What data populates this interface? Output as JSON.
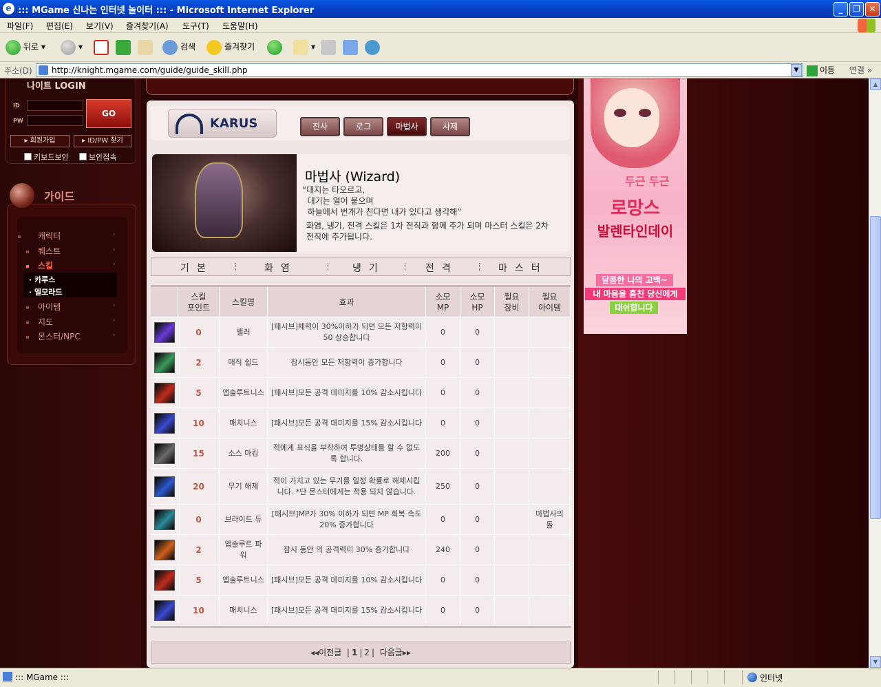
{
  "window": {
    "title": "::: MGame 신나는 인터넷 놀이터 ::: - Microsoft Internet Explorer"
  },
  "menu": [
    "파일(F)",
    "편집(E)",
    "보기(V)",
    "즐겨찾기(A)",
    "도구(T)",
    "도움말(H)"
  ],
  "toolbar": {
    "back": "뒤로",
    "search": "검색",
    "favorites": "즐겨찾기"
  },
  "address": {
    "label": "주소(D)",
    "url": "http://knight.mgame.com/guide/guide_skill.php",
    "go": "이동",
    "links": "연결"
  },
  "login": {
    "title": "나이트 LOGIN",
    "id_label": "ID",
    "pw_label": "PW",
    "go": "GO",
    "join": "회원가입",
    "find": "ID/PW 찾기",
    "keyboard_security": "키보드보안",
    "secure_login": "보안접속"
  },
  "guide": {
    "title": "가이드",
    "items": [
      "캐릭터",
      "퀘스트",
      "스킬",
      "아이템",
      "지도",
      "몬스터/NPC"
    ],
    "active": "스킬",
    "submenu": [
      "· 카루스",
      "· 엘모라드"
    ]
  },
  "faction": {
    "name": "KARUS",
    "classes": [
      "전사",
      "로그",
      "마법사",
      "사제"
    ],
    "active_class": "마법사"
  },
  "banner": {
    "class_name": "마법사 (Wizard)",
    "quote": "“대지는 타오르고,\n  대기는 얼어 붙으며\n  하늘에서 번개가 친다면 내가 있다고 생각해”",
    "description": "화염, 냉기, 전격 스킬은 1차 전직과 함께 추가 되며 마스터 스킬은 2차 전직에 추가됩니다."
  },
  "skill_tabs": [
    "기본",
    "화염",
    "냉기",
    "전격",
    "마스터"
  ],
  "table": {
    "headers": [
      "",
      "스킬\n포인트",
      "스킬명",
      "효과",
      "소모\nMP",
      "소모\nHP",
      "필요\n장비",
      "필요\n아이템"
    ],
    "rows": [
      {
        "icon": "skill-icon-purple-figure",
        "icon_color": "#6a3ad8",
        "point": "0",
        "name": "밸러",
        "effect": "[패시브]체력이 30%이하가 되면 모든 저항력이 50 상승합니다",
        "mp": "0",
        "hp": "0",
        "equip": "",
        "item": ""
      },
      {
        "icon": "skill-icon-green-magic",
        "icon_color": "#3a9a5a",
        "point": "2",
        "name": "매직 쉴드",
        "effect": "잠시동안 모든 저항력이 증가합니다",
        "mp": "0",
        "hp": "0",
        "equip": "",
        "item": ""
      },
      {
        "icon": "skill-icon-red-slash",
        "icon_color": "#c02a1a",
        "point": "5",
        "name": "앱솔루트니스",
        "effect": "[패시브]모든 공격 데미지를 10% 감소시킵니다",
        "mp": "0",
        "hp": "0",
        "equip": "",
        "item": ""
      },
      {
        "icon": "skill-icon-blue-red-slash",
        "icon_color": "#3a4ad0",
        "point": "10",
        "name": "매치니스",
        "effect": "[패시브]모든 공격 데미지를 15% 감소시킵니다",
        "mp": "0",
        "hp": "0",
        "equip": "",
        "item": ""
      },
      {
        "icon": "skill-icon-grey-mark",
        "icon_color": "#6a6a6a",
        "point": "15",
        "name": "소스 마킹",
        "effect": "적에게 표식을 부착하여 투명상태를 할 수 없도록 합니다.",
        "mp": "200",
        "hp": "0",
        "equip": "",
        "item": ""
      },
      {
        "icon": "skill-icon-blue-disarm",
        "icon_color": "#2a5ad0",
        "point": "20",
        "name": "무기 해제",
        "effect": "적이 가지고 있는 무기를 일정 확률로 해제시킵니다. *단 몬스터에게는 적용 되지 않습니다.",
        "mp": "250",
        "hp": "0",
        "equip": "",
        "item": ""
      },
      {
        "icon": "skill-icon-teal-figure",
        "icon_color": "#2a8a9a",
        "point": "0",
        "name": "브라이트 듀",
        "effect": "[패시브]MP가 30% 이하가 되면 MP 회복 속도 20% 증가합니다",
        "mp": "0",
        "hp": "0",
        "equip": "",
        "item": "마법사의 돌"
      },
      {
        "icon": "skill-icon-orange-power",
        "icon_color": "#d0601a",
        "point": "2",
        "name": "앱솔루트 파워",
        "effect": "잠시 동안 의 공격력이 30% 증가합니다",
        "mp": "240",
        "hp": "0",
        "equip": "",
        "item": ""
      },
      {
        "icon": "skill-icon-red-slash",
        "icon_color": "#c02a1a",
        "point": "5",
        "name": "앱솔루트니스",
        "effect": "[패시브]모든 공격 데미지를 10% 감소시킵니다",
        "mp": "0",
        "hp": "0",
        "equip": "",
        "item": ""
      },
      {
        "icon": "skill-icon-blue-red-slash",
        "icon_color": "#3a4ad0",
        "point": "10",
        "name": "매치니스",
        "effect": "[패시브]모든 공격 데미지를 15% 감소시킵니다",
        "mp": "0",
        "hp": "0",
        "equip": "",
        "item": ""
      }
    ]
  },
  "paging": {
    "prev": "◂◂이전글",
    "pages": [
      "1",
      "2"
    ],
    "current": "1",
    "next": "다음글▸▸"
  },
  "ad": {
    "line1": "두근 두근",
    "line2": "로망스",
    "line3": "발렌타인데이",
    "r1": "달콤한 나의 고백~",
    "r2": "내 마음을 훔친 당신에게",
    "r3": "대쉬합니다"
  },
  "status": {
    "text": "::: MGame :::",
    "zone": "인터넷"
  }
}
